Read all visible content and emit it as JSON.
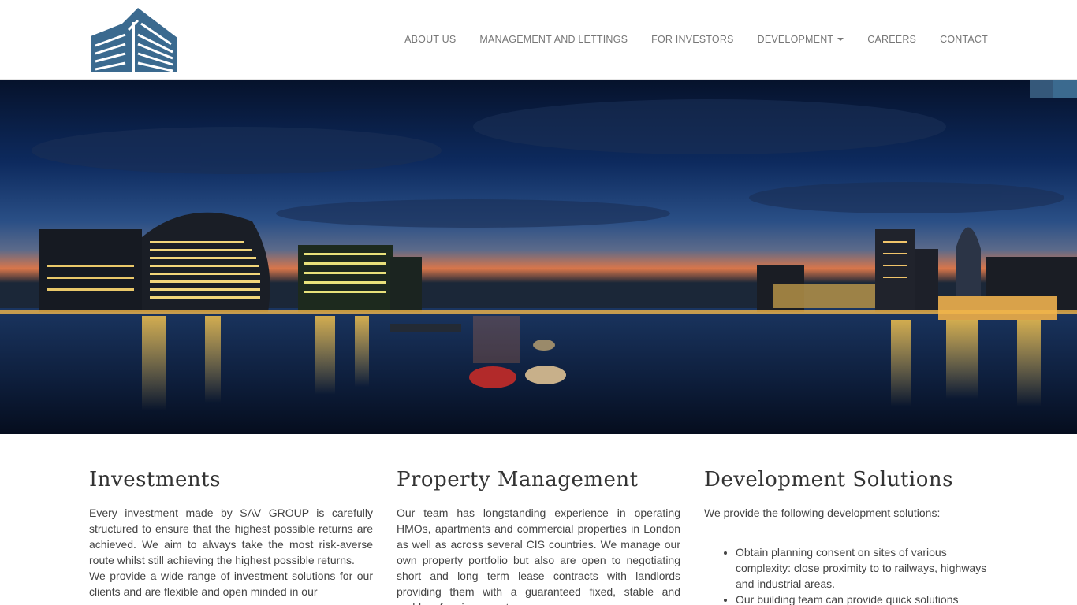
{
  "nav": {
    "items": [
      {
        "label": "ABOUT US"
      },
      {
        "label": "MANAGEMENT AND LETTINGS"
      },
      {
        "label": "FOR INVESTORS"
      },
      {
        "label": "DEVELOPMENT"
      },
      {
        "label": "CAREERS"
      },
      {
        "label": "CONTACT"
      }
    ]
  },
  "logo": {
    "icon": "buildings-logo-icon",
    "color": "#3b6a8f"
  },
  "hero": {
    "icon": "london-skyline-night-photo"
  },
  "columns": {
    "investments": {
      "title": "Investments",
      "p1": "Every investment made by SAV GROUP is carefully structured to ensure that the highest possible returns are achieved. We aim to always take the most risk-averse route whilst still achieving the highest possible returns.",
      "p2": "We provide a wide range of investment solutions for our clients and are flexible and open minded in our"
    },
    "management": {
      "title": "Property Management",
      "p1": "Our team has longstanding experience in operating HMOs, apartments and commercial properties in London as well as across several CIS countries. We manage our own property portfolio but also are open to negotiating short and long term lease contracts with landlords providing them with a guaranteed fixed, stable and problem free income stream."
    },
    "development": {
      "title": "Development Solutions",
      "intro": "We provide the following development solutions:",
      "items": [
        "Obtain planning consent on sites of various complexity: close proximity to to railways, highways and industrial areas.",
        "Our building team can provide quick solutions"
      ]
    }
  },
  "colors": {
    "accent": "#3b6a8f",
    "nav_text": "#777777"
  }
}
